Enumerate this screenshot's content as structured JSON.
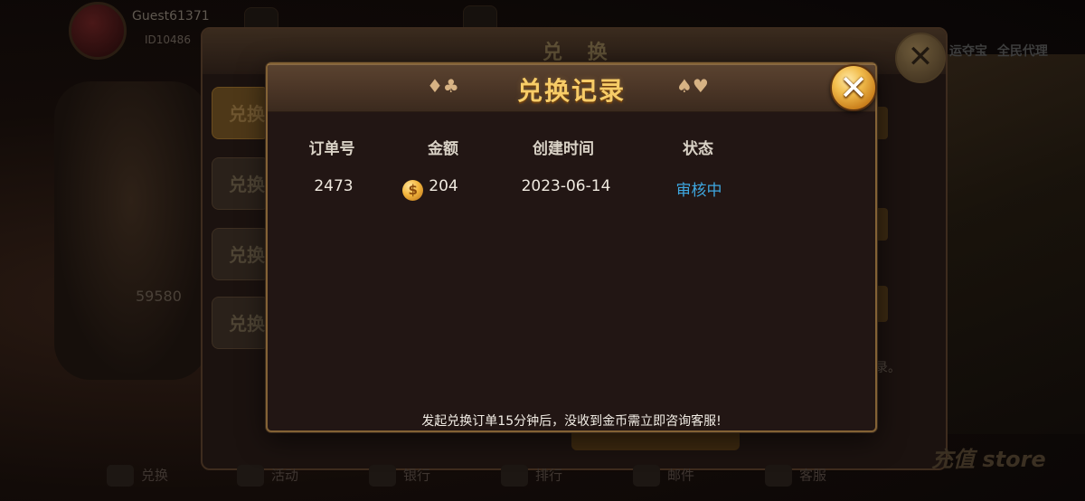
{
  "background": {
    "user": {
      "name": "Guest61371",
      "id": "ID10486"
    },
    "panel_title": "兑 换",
    "side_tabs": [
      "兑换",
      "兑换",
      "兑换",
      "兑换"
    ],
    "balance_fragment": "59580",
    "note_tail": "录。",
    "right_top_labels": [
      "运夺宝",
      "全民代理"
    ],
    "bottom_nav": [
      "兑换",
      "活动",
      "银行",
      "排行",
      "邮件",
      "客服"
    ],
    "store_label": "充值 store"
  },
  "modal": {
    "title": "兑换记录",
    "suits_left": "♦♣",
    "suits_right": "♠♥",
    "close_icon": "close-x-icon",
    "columns": [
      "订单号",
      "金额",
      "创建时间",
      "状态"
    ],
    "rows": [
      {
        "order_no": "2473",
        "amount": "204",
        "created": "2023-06-14",
        "status": "审核中"
      }
    ],
    "footer_note": "发起兑换订单15分钟后，没收到金币需立即咨询客服!"
  },
  "colors": {
    "title_gold": "#f7cc67",
    "status_blue": "#3ea7e0",
    "frame_gold": "#836235"
  }
}
